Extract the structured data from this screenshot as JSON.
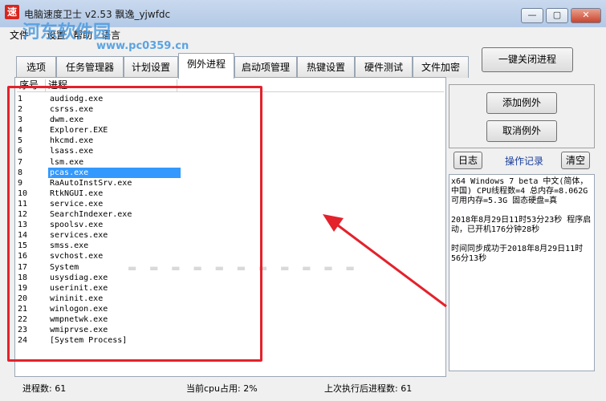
{
  "window": {
    "title": "电脑速度卫士 v2.53   飘逸_yjwfdc",
    "app_icon_glyph": "速",
    "watermark": "河东软件园",
    "watermark_url": "www.pc0359.cn",
    "minimize_label": "—",
    "maximize_label": "▢",
    "close_label": "✕"
  },
  "menu": [
    "文件",
    "设置",
    "帮助",
    "语言"
  ],
  "tabs": [
    {
      "label": "选项"
    },
    {
      "label": "任务管理器"
    },
    {
      "label": "计划设置"
    },
    {
      "label": "例外进程",
      "active": true
    },
    {
      "label": "启动项管理"
    },
    {
      "label": "热键设置"
    },
    {
      "label": "硬件测试"
    },
    {
      "label": "文件加密"
    }
  ],
  "kill_all_button": "一键关闭进程",
  "process_list": {
    "headers": {
      "seq": "序号",
      "process": "进程"
    },
    "selected_index": 7,
    "rows": [
      {
        "num": "1",
        "name": "audiodg.exe"
      },
      {
        "num": "2",
        "name": "csrss.exe"
      },
      {
        "num": "3",
        "name": "dwm.exe"
      },
      {
        "num": "4",
        "name": "Explorer.EXE"
      },
      {
        "num": "5",
        "name": "hkcmd.exe"
      },
      {
        "num": "6",
        "name": "lsass.exe"
      },
      {
        "num": "7",
        "name": "lsm.exe"
      },
      {
        "num": "8",
        "name": "pcas.exe"
      },
      {
        "num": "9",
        "name": "RaAutoInstSrv.exe"
      },
      {
        "num": "10",
        "name": "RtkNGUI.exe"
      },
      {
        "num": "11",
        "name": "service.exe"
      },
      {
        "num": "12",
        "name": "SearchIndexer.exe"
      },
      {
        "num": "13",
        "name": "spoolsv.exe"
      },
      {
        "num": "14",
        "name": "services.exe"
      },
      {
        "num": "15",
        "name": "smss.exe"
      },
      {
        "num": "16",
        "name": "svchost.exe"
      },
      {
        "num": "17",
        "name": "System"
      },
      {
        "num": "18",
        "name": "usysdiag.exe"
      },
      {
        "num": "19",
        "name": "userinit.exe"
      },
      {
        "num": "20",
        "name": "wininit.exe"
      },
      {
        "num": "21",
        "name": "winlogon.exe"
      },
      {
        "num": "22",
        "name": "wmpnetwk.exe"
      },
      {
        "num": "23",
        "name": "wmiprvse.exe"
      },
      {
        "num": "24",
        "name": "[System Process]"
      }
    ]
  },
  "side": {
    "add_exception": "添加例外",
    "cancel_exception": "取消例外",
    "log_button": "日志",
    "log_label": "操作记录",
    "clear_button": "清空",
    "log_lines": [
      "x64 Windows 7 beta  中文(简体，中国) CPU线程数=4 总内存=8.062G 可用内存=5.3G 固态硬盘=真",
      " 2018年8月29日11时53分23秒  程序启动，已开机176分钟28秒",
      "时间同步成功于2018年8月29日11时56分13秒"
    ]
  },
  "status": {
    "process_count": "进程数: 61",
    "cpu_usage": "当前cpu占用: 2%",
    "after_exec_count": "上次执行后进程数: 61"
  },
  "colors": {
    "annotation_red": "#e3222c",
    "selection_blue": "#3399ff"
  }
}
